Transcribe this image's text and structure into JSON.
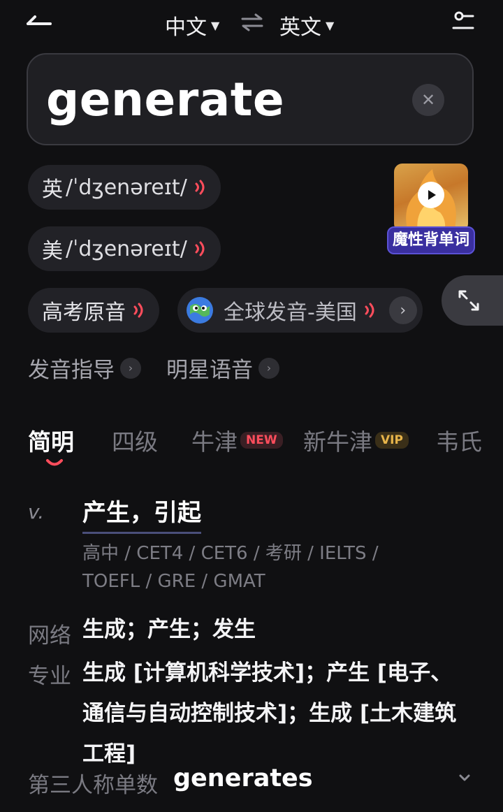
{
  "header": {
    "source_lang": "中文",
    "target_lang": "英文"
  },
  "search": {
    "word": "generate"
  },
  "pronunciations": [
    {
      "region": "英",
      "phonetic": "/ˈdʒenəreɪt/"
    },
    {
      "region": "美",
      "phonetic": "/ˈdʒenəreɪt/"
    }
  ],
  "audio_options": {
    "exam": "高考原音",
    "global": "全球发音-美国"
  },
  "ad": {
    "label": "魔性背单词"
  },
  "guides": {
    "pronunciation_guide": "发音指导",
    "celebrity_voice": "明星语音"
  },
  "tabs": [
    {
      "label": "简明"
    },
    {
      "label": "四级"
    },
    {
      "label": "牛津",
      "badge": "NEW"
    },
    {
      "label": "新牛津",
      "badge": "VIP"
    },
    {
      "label": "韦氏"
    }
  ],
  "definition": {
    "pos": "v.",
    "meaning": "产生，引起",
    "levels_line1": "高中 / CET4 / CET6 / 考研 / IELTS /",
    "levels_line2": "TOEFL / GRE / GMAT"
  },
  "extra": {
    "web_label": "网络",
    "web_text": "生成；产生；发生",
    "pro_label": "专业",
    "pro_line1": "生成 [计算机科学技术]；产生 [电子、",
    "pro_line2": "通信与自动控制技术]；生成 [土木建筑",
    "pro_line3": "工程]",
    "third_person_label": "第三人称单数",
    "third_person_word": "generates"
  },
  "colors": {
    "background": "#101012",
    "accent_red": "#ff4d5c",
    "vip_gold": "#e7b44a"
  }
}
